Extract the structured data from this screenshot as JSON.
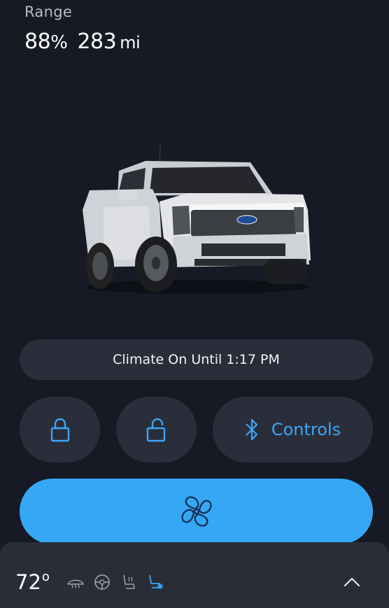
{
  "range": {
    "label": "Range",
    "percent": "88",
    "percent_unit": "%",
    "miles": "283",
    "miles_unit": "mi"
  },
  "vehicle": {
    "image": "truck-image",
    "color": "#d9dbde"
  },
  "climate_status": "Climate On Until 1:17 PM",
  "controls": {
    "lock_icon": "lock-icon",
    "unlock_icon": "unlock-icon",
    "bluetooth_icon": "bluetooth-icon",
    "controls_label": "Controls"
  },
  "fan": {
    "icon": "fan-icon",
    "color": "#35a7f5"
  },
  "bottom_bar": {
    "temperature": "72",
    "degree": "o",
    "icons": [
      "defrost-icon",
      "heated-steering-icon",
      "heated-seat-icon",
      "cooled-seat-icon"
    ],
    "active_icon": "cooled-seat-icon",
    "active_color": "#3ba6f5",
    "expand_icon": "chevron-up-icon"
  },
  "colors": {
    "background": "#171a24",
    "pill": "#2a2e3a",
    "accent": "#3ba6f5"
  }
}
